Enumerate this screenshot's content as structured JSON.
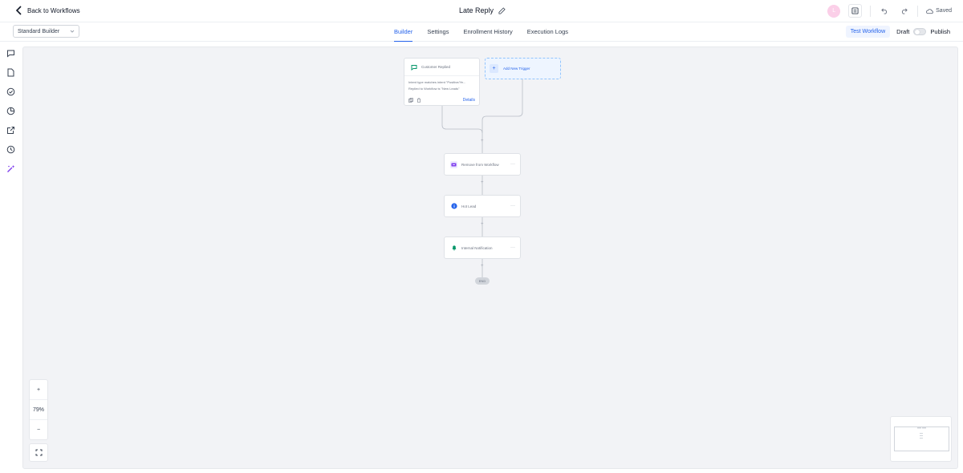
{
  "header": {
    "back_label": "Back to Workflows",
    "workflow_title": "Late Reply",
    "avatar_initial": "L",
    "saved_label": "Saved"
  },
  "subbar": {
    "builder_select": "Standard Builder",
    "tabs": [
      {
        "label": "Builder",
        "active": true
      },
      {
        "label": "Settings",
        "active": false
      },
      {
        "label": "Enrollment History",
        "active": false
      },
      {
        "label": "Execution Logs",
        "active": false
      }
    ],
    "test_button": "Test Workflow",
    "draft_label": "Draft",
    "publish_label": "Publish"
  },
  "sidebar": {
    "icons": [
      "chat-icon",
      "document-icon",
      "check-circle-icon",
      "pie-chart-icon",
      "external-link-icon",
      "history-icon",
      "magic-wand-icon"
    ]
  },
  "canvas": {
    "trigger": {
      "title": "Customer Replied",
      "line1": "Intent type matches intent \"Positive/Ye...",
      "line2": "Replied to Workflow is \"New Leads\"",
      "details_label": "Details"
    },
    "add_trigger_label": "Add New Trigger",
    "actions": [
      {
        "label": "Remove from Workflow",
        "icon": "remove-workflow-icon",
        "color": "#7c3aed"
      },
      {
        "label": "Hot Lead",
        "icon": "info-icon",
        "color": "#2563eb"
      },
      {
        "label": "Internal Notification",
        "icon": "notification-icon",
        "color": "#059669"
      }
    ],
    "end_label": "END"
  },
  "zoom": {
    "plus": "+",
    "level": "79%",
    "minus": "−"
  },
  "colors": {
    "accent": "#2563eb",
    "canvas_bg": "#f2f3f6"
  }
}
